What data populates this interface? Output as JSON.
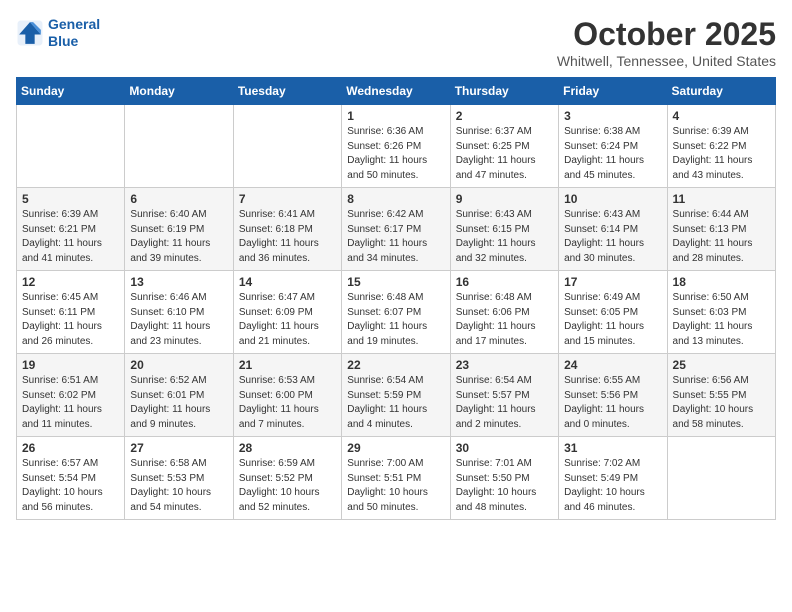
{
  "header": {
    "logo_line1": "General",
    "logo_line2": "Blue",
    "month": "October 2025",
    "location": "Whitwell, Tennessee, United States"
  },
  "weekdays": [
    "Sunday",
    "Monday",
    "Tuesday",
    "Wednesday",
    "Thursday",
    "Friday",
    "Saturday"
  ],
  "weeks": [
    [
      {
        "day": "",
        "content": ""
      },
      {
        "day": "",
        "content": ""
      },
      {
        "day": "",
        "content": ""
      },
      {
        "day": "1",
        "content": "Sunrise: 6:36 AM\nSunset: 6:26 PM\nDaylight: 11 hours and 50 minutes."
      },
      {
        "day": "2",
        "content": "Sunrise: 6:37 AM\nSunset: 6:25 PM\nDaylight: 11 hours and 47 minutes."
      },
      {
        "day": "3",
        "content": "Sunrise: 6:38 AM\nSunset: 6:24 PM\nDaylight: 11 hours and 45 minutes."
      },
      {
        "day": "4",
        "content": "Sunrise: 6:39 AM\nSunset: 6:22 PM\nDaylight: 11 hours and 43 minutes."
      }
    ],
    [
      {
        "day": "5",
        "content": "Sunrise: 6:39 AM\nSunset: 6:21 PM\nDaylight: 11 hours and 41 minutes."
      },
      {
        "day": "6",
        "content": "Sunrise: 6:40 AM\nSunset: 6:19 PM\nDaylight: 11 hours and 39 minutes."
      },
      {
        "day": "7",
        "content": "Sunrise: 6:41 AM\nSunset: 6:18 PM\nDaylight: 11 hours and 36 minutes."
      },
      {
        "day": "8",
        "content": "Sunrise: 6:42 AM\nSunset: 6:17 PM\nDaylight: 11 hours and 34 minutes."
      },
      {
        "day": "9",
        "content": "Sunrise: 6:43 AM\nSunset: 6:15 PM\nDaylight: 11 hours and 32 minutes."
      },
      {
        "day": "10",
        "content": "Sunrise: 6:43 AM\nSunset: 6:14 PM\nDaylight: 11 hours and 30 minutes."
      },
      {
        "day": "11",
        "content": "Sunrise: 6:44 AM\nSunset: 6:13 PM\nDaylight: 11 hours and 28 minutes."
      }
    ],
    [
      {
        "day": "12",
        "content": "Sunrise: 6:45 AM\nSunset: 6:11 PM\nDaylight: 11 hours and 26 minutes."
      },
      {
        "day": "13",
        "content": "Sunrise: 6:46 AM\nSunset: 6:10 PM\nDaylight: 11 hours and 23 minutes."
      },
      {
        "day": "14",
        "content": "Sunrise: 6:47 AM\nSunset: 6:09 PM\nDaylight: 11 hours and 21 minutes."
      },
      {
        "day": "15",
        "content": "Sunrise: 6:48 AM\nSunset: 6:07 PM\nDaylight: 11 hours and 19 minutes."
      },
      {
        "day": "16",
        "content": "Sunrise: 6:48 AM\nSunset: 6:06 PM\nDaylight: 11 hours and 17 minutes."
      },
      {
        "day": "17",
        "content": "Sunrise: 6:49 AM\nSunset: 6:05 PM\nDaylight: 11 hours and 15 minutes."
      },
      {
        "day": "18",
        "content": "Sunrise: 6:50 AM\nSunset: 6:03 PM\nDaylight: 11 hours and 13 minutes."
      }
    ],
    [
      {
        "day": "19",
        "content": "Sunrise: 6:51 AM\nSunset: 6:02 PM\nDaylight: 11 hours and 11 minutes."
      },
      {
        "day": "20",
        "content": "Sunrise: 6:52 AM\nSunset: 6:01 PM\nDaylight: 11 hours and 9 minutes."
      },
      {
        "day": "21",
        "content": "Sunrise: 6:53 AM\nSunset: 6:00 PM\nDaylight: 11 hours and 7 minutes."
      },
      {
        "day": "22",
        "content": "Sunrise: 6:54 AM\nSunset: 5:59 PM\nDaylight: 11 hours and 4 minutes."
      },
      {
        "day": "23",
        "content": "Sunrise: 6:54 AM\nSunset: 5:57 PM\nDaylight: 11 hours and 2 minutes."
      },
      {
        "day": "24",
        "content": "Sunrise: 6:55 AM\nSunset: 5:56 PM\nDaylight: 11 hours and 0 minutes."
      },
      {
        "day": "25",
        "content": "Sunrise: 6:56 AM\nSunset: 5:55 PM\nDaylight: 10 hours and 58 minutes."
      }
    ],
    [
      {
        "day": "26",
        "content": "Sunrise: 6:57 AM\nSunset: 5:54 PM\nDaylight: 10 hours and 56 minutes."
      },
      {
        "day": "27",
        "content": "Sunrise: 6:58 AM\nSunset: 5:53 PM\nDaylight: 10 hours and 54 minutes."
      },
      {
        "day": "28",
        "content": "Sunrise: 6:59 AM\nSunset: 5:52 PM\nDaylight: 10 hours and 52 minutes."
      },
      {
        "day": "29",
        "content": "Sunrise: 7:00 AM\nSunset: 5:51 PM\nDaylight: 10 hours and 50 minutes."
      },
      {
        "day": "30",
        "content": "Sunrise: 7:01 AM\nSunset: 5:50 PM\nDaylight: 10 hours and 48 minutes."
      },
      {
        "day": "31",
        "content": "Sunrise: 7:02 AM\nSunset: 5:49 PM\nDaylight: 10 hours and 46 minutes."
      },
      {
        "day": "",
        "content": ""
      }
    ]
  ]
}
